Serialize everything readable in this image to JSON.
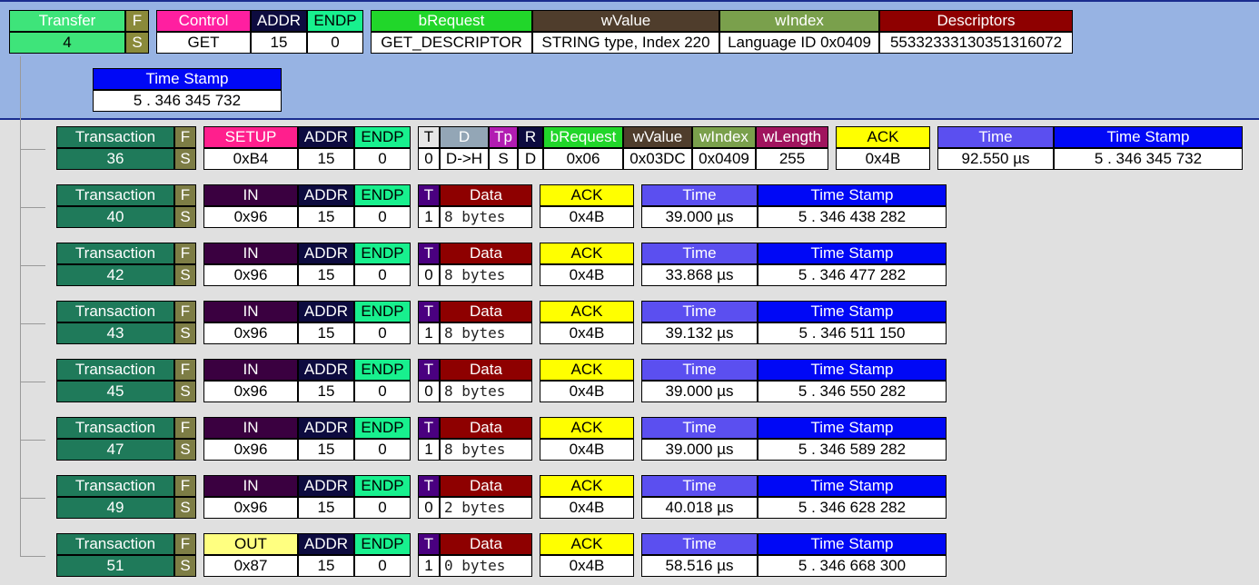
{
  "transfer": {
    "transfer": {
      "label": "Transfer",
      "value": "4"
    },
    "f_label": "F",
    "s_label": "S",
    "control": {
      "label": "Control",
      "value": "GET"
    },
    "addr": {
      "label": "ADDR",
      "value": "15"
    },
    "endp": {
      "label": "ENDP",
      "value": "0"
    },
    "brequest": {
      "label": "bRequest",
      "value": "GET_DESCRIPTOR"
    },
    "wvalue": {
      "label": "wValue",
      "value": "STRING type, Index 220"
    },
    "windex": {
      "label": "wIndex",
      "value": "Language ID 0x0409"
    },
    "descriptors": {
      "label": "Descriptors",
      "value": "55332333130351316072"
    },
    "timestamp": {
      "label": "Time Stamp",
      "value": "5 . 346 345 732"
    }
  },
  "setup": {
    "transaction": {
      "label": "Transaction",
      "value": "36"
    },
    "f_label": "F",
    "s_label": "S",
    "pid": {
      "label": "SETUP",
      "value": "0xB4"
    },
    "addr": {
      "label": "ADDR",
      "value": "15"
    },
    "endp": {
      "label": "ENDP",
      "value": "0"
    },
    "t": {
      "label": "T",
      "value": "0"
    },
    "d": {
      "label": "D",
      "value": "D->H"
    },
    "tp": {
      "label": "Tp",
      "value": "S"
    },
    "r": {
      "label": "R",
      "value": "D"
    },
    "brequest": {
      "label": "bRequest",
      "value": "0x06"
    },
    "wvalue": {
      "label": "wValue",
      "value": "0x03DC"
    },
    "windex": {
      "label": "wIndex",
      "value": "0x0409"
    },
    "wlength": {
      "label": "wLength",
      "value": "255"
    },
    "ack": {
      "label": "ACK",
      "value": "0x4B"
    },
    "time": {
      "label": "Time",
      "value": "92.550 µs"
    },
    "timestamp": {
      "label": "Time Stamp",
      "value": "5 . 346 345 732"
    }
  },
  "transactions": [
    {
      "transaction": {
        "label": "Transaction",
        "value": "40"
      },
      "f_label": "F",
      "s_label": "S",
      "pid": {
        "label": "IN",
        "value": "0x96"
      },
      "addr": {
        "label": "ADDR",
        "value": "15"
      },
      "endp": {
        "label": "ENDP",
        "value": "0"
      },
      "t": {
        "label": "T",
        "value": "1"
      },
      "data": {
        "label": "Data",
        "value": "8 bytes"
      },
      "ack": {
        "label": "ACK",
        "value": "0x4B"
      },
      "time": {
        "label": "Time",
        "value": "39.000 µs"
      },
      "timestamp": {
        "label": "Time Stamp",
        "value": "5 . 346 438 282"
      }
    },
    {
      "transaction": {
        "label": "Transaction",
        "value": "42"
      },
      "f_label": "F",
      "s_label": "S",
      "pid": {
        "label": "IN",
        "value": "0x96"
      },
      "addr": {
        "label": "ADDR",
        "value": "15"
      },
      "endp": {
        "label": "ENDP",
        "value": "0"
      },
      "t": {
        "label": "T",
        "value": "0"
      },
      "data": {
        "label": "Data",
        "value": "8 bytes"
      },
      "ack": {
        "label": "ACK",
        "value": "0x4B"
      },
      "time": {
        "label": "Time",
        "value": "33.868 µs"
      },
      "timestamp": {
        "label": "Time Stamp",
        "value": "5 . 346 477 282"
      }
    },
    {
      "transaction": {
        "label": "Transaction",
        "value": "43"
      },
      "f_label": "F",
      "s_label": "S",
      "pid": {
        "label": "IN",
        "value": "0x96"
      },
      "addr": {
        "label": "ADDR",
        "value": "15"
      },
      "endp": {
        "label": "ENDP",
        "value": "0"
      },
      "t": {
        "label": "T",
        "value": "1"
      },
      "data": {
        "label": "Data",
        "value": "8 bytes"
      },
      "ack": {
        "label": "ACK",
        "value": "0x4B"
      },
      "time": {
        "label": "Time",
        "value": "39.132 µs"
      },
      "timestamp": {
        "label": "Time Stamp",
        "value": "5 . 346 511 150"
      }
    },
    {
      "transaction": {
        "label": "Transaction",
        "value": "45"
      },
      "f_label": "F",
      "s_label": "S",
      "pid": {
        "label": "IN",
        "value": "0x96"
      },
      "addr": {
        "label": "ADDR",
        "value": "15"
      },
      "endp": {
        "label": "ENDP",
        "value": "0"
      },
      "t": {
        "label": "T",
        "value": "0"
      },
      "data": {
        "label": "Data",
        "value": "8 bytes"
      },
      "ack": {
        "label": "ACK",
        "value": "0x4B"
      },
      "time": {
        "label": "Time",
        "value": "39.000 µs"
      },
      "timestamp": {
        "label": "Time Stamp",
        "value": "5 . 346 550 282"
      }
    },
    {
      "transaction": {
        "label": "Transaction",
        "value": "47"
      },
      "f_label": "F",
      "s_label": "S",
      "pid": {
        "label": "IN",
        "value": "0x96"
      },
      "addr": {
        "label": "ADDR",
        "value": "15"
      },
      "endp": {
        "label": "ENDP",
        "value": "0"
      },
      "t": {
        "label": "T",
        "value": "1"
      },
      "data": {
        "label": "Data",
        "value": "8 bytes"
      },
      "ack": {
        "label": "ACK",
        "value": "0x4B"
      },
      "time": {
        "label": "Time",
        "value": "39.000 µs"
      },
      "timestamp": {
        "label": "Time Stamp",
        "value": "5 . 346 589 282"
      }
    },
    {
      "transaction": {
        "label": "Transaction",
        "value": "49"
      },
      "f_label": "F",
      "s_label": "S",
      "pid": {
        "label": "IN",
        "value": "0x96"
      },
      "addr": {
        "label": "ADDR",
        "value": "15"
      },
      "endp": {
        "label": "ENDP",
        "value": "0"
      },
      "t": {
        "label": "T",
        "value": "0"
      },
      "data": {
        "label": "Data",
        "value": "2 bytes"
      },
      "ack": {
        "label": "ACK",
        "value": "0x4B"
      },
      "time": {
        "label": "Time",
        "value": "40.018 µs"
      },
      "timestamp": {
        "label": "Time Stamp",
        "value": "5 . 346 628 282"
      }
    },
    {
      "transaction": {
        "label": "Transaction",
        "value": "51"
      },
      "f_label": "F",
      "s_label": "S",
      "pid": {
        "label": "OUT",
        "value": "0x87"
      },
      "addr": {
        "label": "ADDR",
        "value": "15"
      },
      "endp": {
        "label": "ENDP",
        "value": "0"
      },
      "t": {
        "label": "T",
        "value": "1"
      },
      "data": {
        "label": "Data",
        "value": "0 bytes"
      },
      "ack": {
        "label": "ACK",
        "value": "0x4B"
      },
      "time": {
        "label": "Time",
        "value": "58.516 µs"
      },
      "timestamp": {
        "label": "Time Stamp",
        "value": "5 . 346 668 300"
      }
    }
  ],
  "colors": {
    "transfer": "#3ee47a",
    "fs_transfer": "#8a8a3a",
    "control": "#ff1fa0",
    "addr": "#0d0b3f",
    "endp": "#18f08e",
    "brequest": "#21d62a",
    "wvalue": "#4f3d2c",
    "windex": "#7aa04c",
    "descriptors": "#8e0000",
    "timestamp": "#0008f6",
    "transaction": "#1f7a5a",
    "fs": "#7d7d45",
    "setup": "#ff1f8d",
    "in": "#3a0040",
    "out": "#ffff80",
    "t_bg": "#e6e6e6",
    "t_in": "#4a0080",
    "d": "#93a6b6",
    "tp": "#b21cb2",
    "r": "#0d0b3f",
    "wlength": "#a0145e",
    "ack": "#ffff00",
    "time": "#5b4ff0",
    "data": "#8e0000"
  }
}
